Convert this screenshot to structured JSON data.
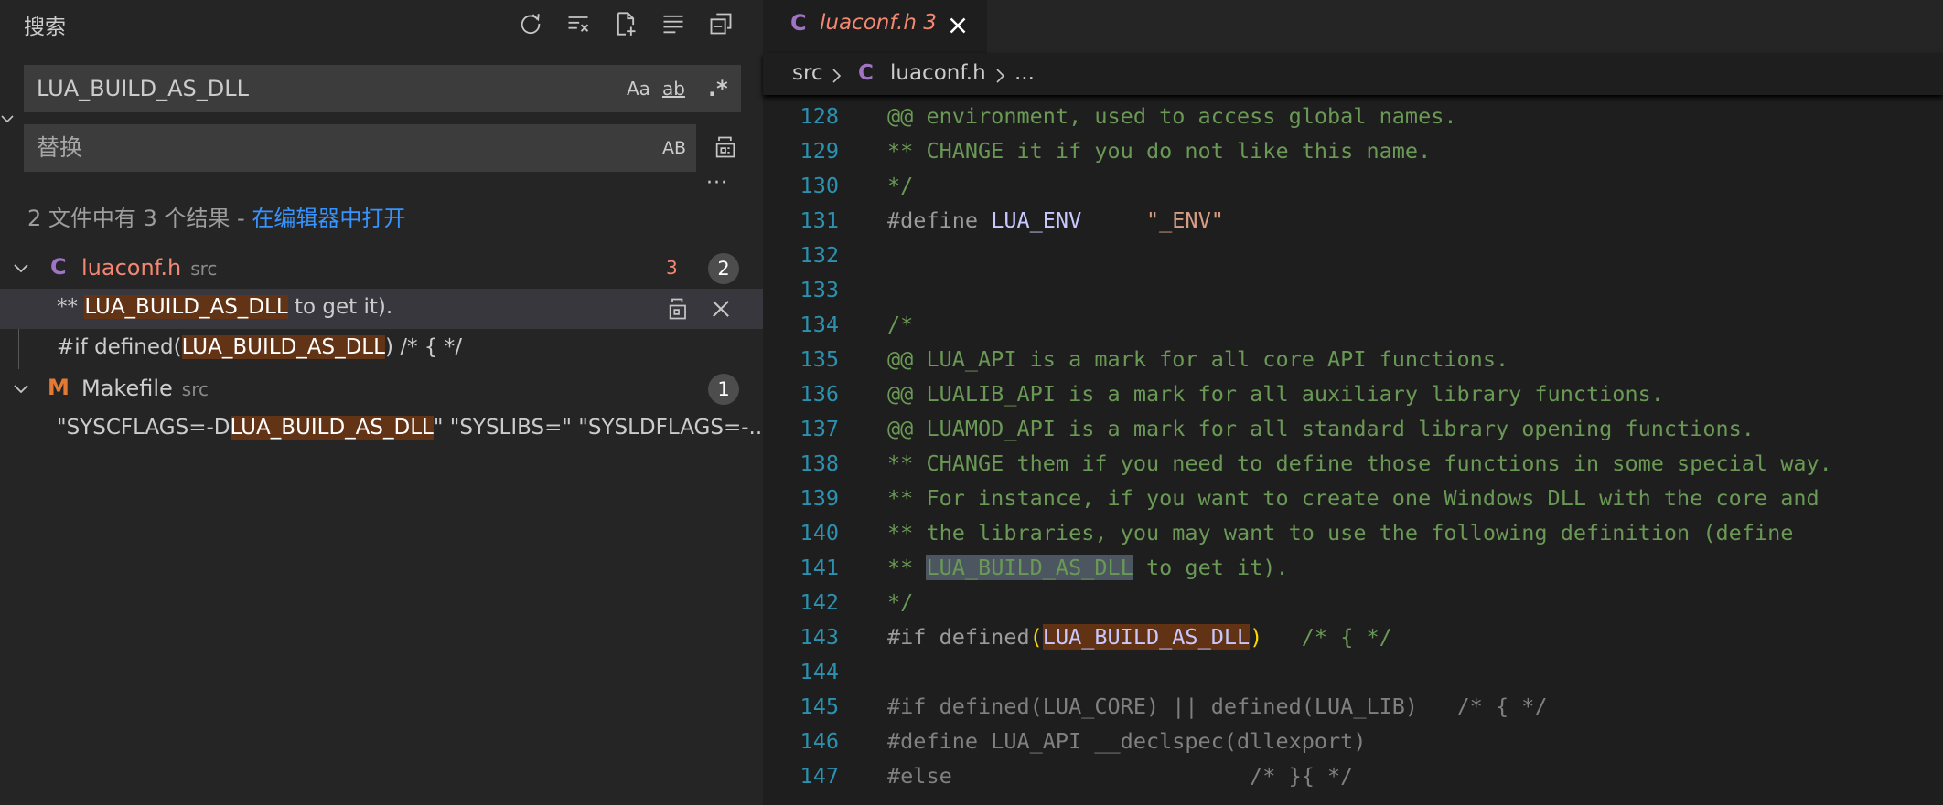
{
  "sidebar": {
    "title": "搜索",
    "actions": [
      "refresh-icon",
      "clear-results-icon",
      "new-search-editor-icon",
      "view-as-tree-icon",
      "collapse-all-icon"
    ],
    "search": {
      "value": "LUA_BUILD_AS_DLL",
      "match_case": "Aa",
      "whole_word": "ab",
      "regex": ".*"
    },
    "replace": {
      "placeholder": "替换",
      "preserve_case": "AB"
    },
    "more": "···",
    "summary": {
      "text": "2 文件中有 3 个结果 - ",
      "link": "在编辑器中打开"
    },
    "files": [
      {
        "icon": "C",
        "name": "luaconf.h",
        "dir": "src",
        "count_red": "3",
        "count": "2",
        "matches": [
          {
            "before": "** ",
            "hit": "LUA_BUILD_AS_DLL",
            "after": " to get it)."
          },
          {
            "before": "#if defined(",
            "hit": "LUA_BUILD_AS_DLL",
            "after": ")     /* { */"
          }
        ]
      },
      {
        "icon": "M",
        "name": "Makefile",
        "dir": "src",
        "count": "1",
        "matches": [
          {
            "before": "\"SYSCFLAGS=-D",
            "hit": "LUA_BUILD_AS_DLL",
            "after": "\" \"SYSLIBS=\" \"SYSLDFLAGS=-..."
          }
        ]
      }
    ]
  },
  "editor": {
    "tab": {
      "icon": "C",
      "name": "luaconf.h",
      "badge": "3"
    },
    "breadcrumb": {
      "folder": "src",
      "icon": "C",
      "file": "luaconf.h",
      "more": "..."
    },
    "lines": [
      {
        "n": "128",
        "t": "@@ environment, used to access global names."
      },
      {
        "n": "129",
        "t": "** CHANGE it if you do not like this name."
      },
      {
        "n": "130",
        "t": "*/"
      },
      {
        "n": "131",
        "pp": "#define ",
        "mac": "LUA_ENV",
        "str": "\"_ENV\""
      },
      {
        "n": "132",
        "t": ""
      },
      {
        "n": "133",
        "t": ""
      },
      {
        "n": "134",
        "t": "/*"
      },
      {
        "n": "135",
        "t": "@@ LUA_API is a mark for all core API functions."
      },
      {
        "n": "136",
        "t": "@@ LUALIB_API is a mark for all auxiliary library functions."
      },
      {
        "n": "137",
        "t": "@@ LUAMOD_API is a mark for all standard library opening functions."
      },
      {
        "n": "138",
        "t": "** CHANGE them if you need to define those functions in some special way."
      },
      {
        "n": "139",
        "t": "** For instance, if you want to create one Windows DLL with the core and"
      },
      {
        "n": "140",
        "t": "** the libraries, you may want to use the following definition (define"
      },
      {
        "n": "141",
        "a": "** ",
        "hit": "LUA_BUILD_AS_DLL",
        "b": " to get it)."
      },
      {
        "n": "142",
        "t": "*/"
      },
      {
        "n": "143",
        "a": "#if defined",
        "hit": "LUA_BUILD_AS_DLL",
        "b": "   /* { */"
      },
      {
        "n": "144",
        "t": ""
      },
      {
        "n": "145",
        "t": "#if defined(LUA_CORE) || defined(LUA_LIB)   /* { */"
      },
      {
        "n": "146",
        "t": "#define LUA_API __declspec(dllexport)"
      },
      {
        "n": "147",
        "t": "#else                       /* }{ */"
      }
    ]
  }
}
